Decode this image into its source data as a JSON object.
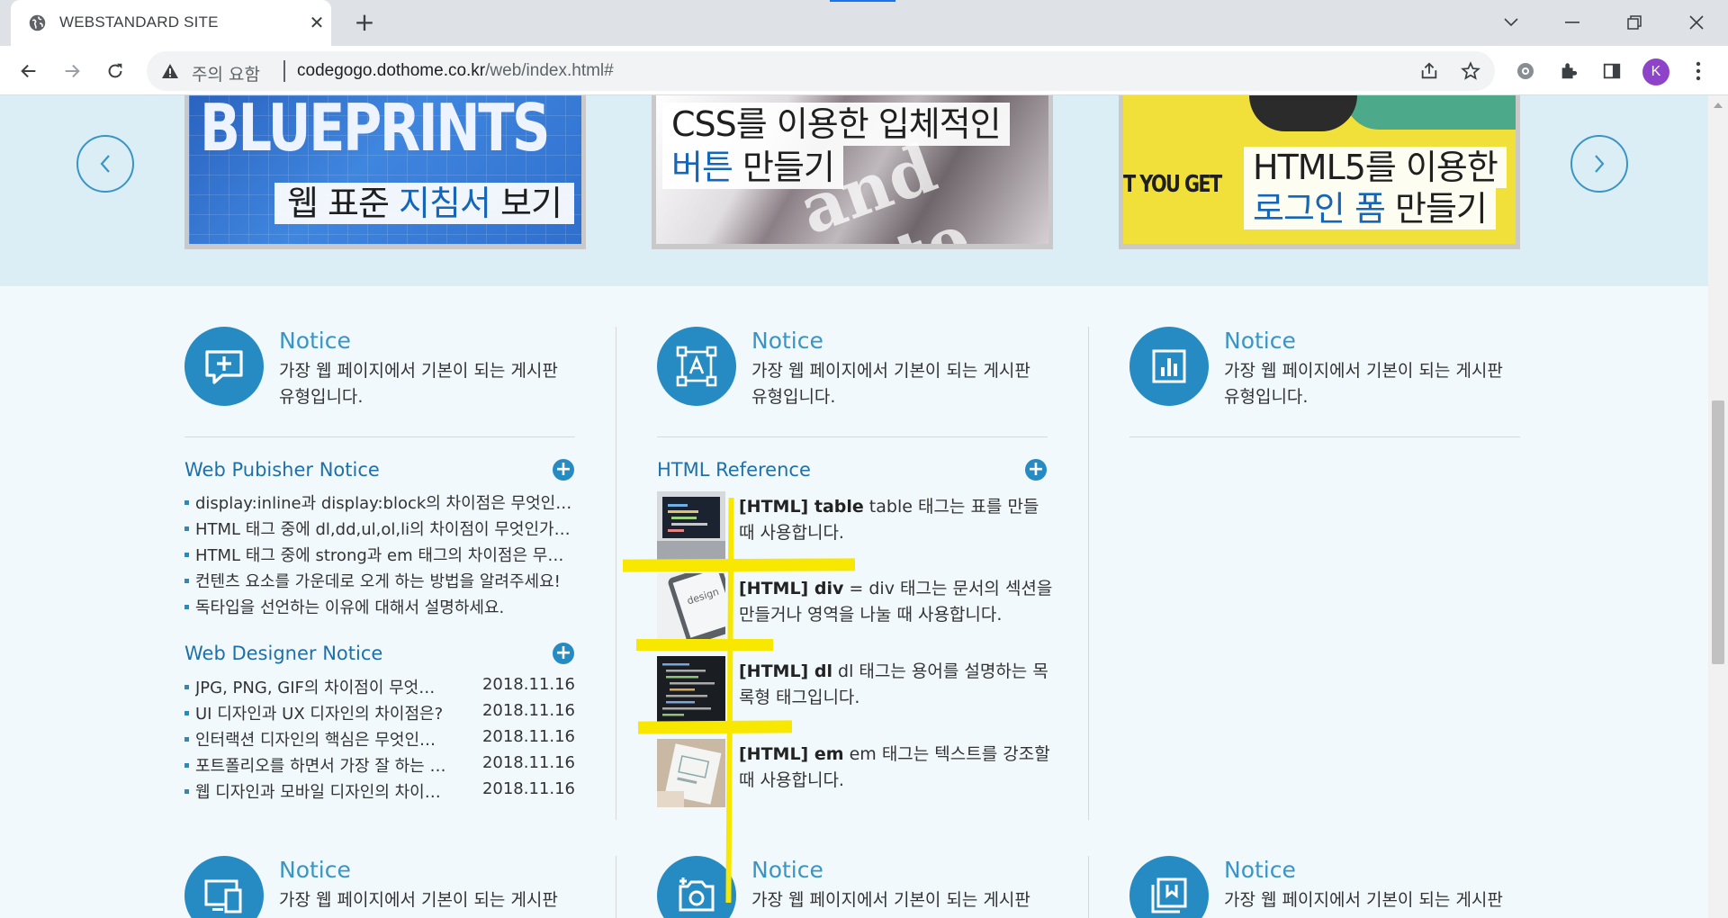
{
  "browser": {
    "tab_title": "WEBSTANDARD SITE",
    "tab_close": "✕",
    "new_tab": "+",
    "security_label": "주의 요함",
    "url_host": "codegogo.dothome.co.kr",
    "url_path": "/web/index.html#",
    "profile_initial": "K"
  },
  "slider": {
    "banners": [
      {
        "big_text": "BLUEPRINTS",
        "caption_plain": "웹 표준 ",
        "caption_hl": "지침서",
        "caption_tail": " 보기"
      },
      {
        "caption_line1": "CSS를 이용한 입체적인",
        "caption_hl": "버튼",
        "caption_tail": " 만들기",
        "ghost": "and inte"
      },
      {
        "side_text": "T YOU GET",
        "caption_line1": "HTML5를 이용한",
        "caption_hl": "로그인 폼",
        "caption_tail": " 만들기"
      }
    ]
  },
  "columns": [
    {
      "notice": {
        "title": "Notice",
        "desc": "가장 웹 페이지에서 기본이 되는 게시판 유형입니다."
      },
      "lists": [
        {
          "title": "Web Pubisher Notice",
          "items": [
            {
              "text": "display:inline과 display:block의 차이점은 무엇인가요?"
            },
            {
              "text": "HTML 태그 중에 dl,dd,ul,ol,li의 차이점이 무엇인가요?"
            },
            {
              "text": "HTML 태그 중에 strong과 em 태그의 차이점은 무엇인가요?"
            },
            {
              "text": "컨텐츠 요소를 가운데로 오게 하는 방법을 알려주세요!"
            },
            {
              "text": "독타입을 선언하는 이유에 대해서 설명하세요."
            }
          ]
        },
        {
          "title": "Web Designer Notice",
          "items": [
            {
              "text": "JPG, PNG, GIF의 차이점이 무엇인가요?",
              "date": "2018.11.16"
            },
            {
              "text": "UI 디자인과 UX 디자인의 차이점은?",
              "date": "2018.11.16"
            },
            {
              "text": "인터랙션 디자인의 핵심은 무엇인가요?",
              "date": "2018.11.16"
            },
            {
              "text": "포트폴리오를 하면서 가장 잘 하는 방법은?",
              "date": "2018.11.16"
            },
            {
              "text": "웹 디자인과 모바일 디자인의 차이점은?",
              "date": "2018.11.16"
            }
          ]
        }
      ]
    },
    {
      "notice": {
        "title": "Notice",
        "desc": "가장 웹 페이지에서 기본이 되는 게시판 유형입니다."
      },
      "reference": {
        "title": "HTML Reference",
        "items": [
          {
            "tag": "[HTML] table",
            "desc": " table 태그는 표를 만들 때 사용합니다."
          },
          {
            "tag": "[HTML] div",
            "desc": " = div 태그는 문서의 섹션을 만들거나 영역을 나눌 때 사용합니다."
          },
          {
            "tag": "[HTML] dl",
            "desc": " dl 태그는 용어를 설명하는 목록형 태그입니다."
          },
          {
            "tag": "[HTML] em",
            "desc": " em 태그는 텍스트를 강조할 때 사용합니다."
          }
        ]
      }
    },
    {
      "notice": {
        "title": "Notice",
        "desc": "가장 웹 페이지에서 기본이 되는 게시판 유형입니다."
      }
    }
  ],
  "bottom_notices": [
    {
      "title": "Notice",
      "desc": "가장 웹 페이지에서 기본이 되는 게시판"
    },
    {
      "title": "Notice",
      "desc": "가장 웹 페이지에서 기본이 되는 게시판"
    },
    {
      "title": "Notice",
      "desc": "가장 웹 페이지에서 기본이 되는 게시판"
    }
  ],
  "colors": {
    "accent": "#258bc2",
    "title_blue": "#1f70a8",
    "highlight_marker": "#f8e800",
    "slider_band": "#dbeef6"
  },
  "icons": [
    "globe-icon",
    "close-icon",
    "plus-icon",
    "back-arrow-icon",
    "forward-arrow-icon",
    "reload-icon",
    "warning-icon",
    "share-icon",
    "star-icon",
    "extension-gear-icon",
    "puzzle-icon",
    "side-panel-icon",
    "kebab-menu-icon",
    "chevron-left-icon",
    "chevron-right-icon",
    "chat-plus-icon",
    "text-frame-icon",
    "chart-icon",
    "display-icon",
    "camera-plus-icon",
    "gallery-icon"
  ]
}
